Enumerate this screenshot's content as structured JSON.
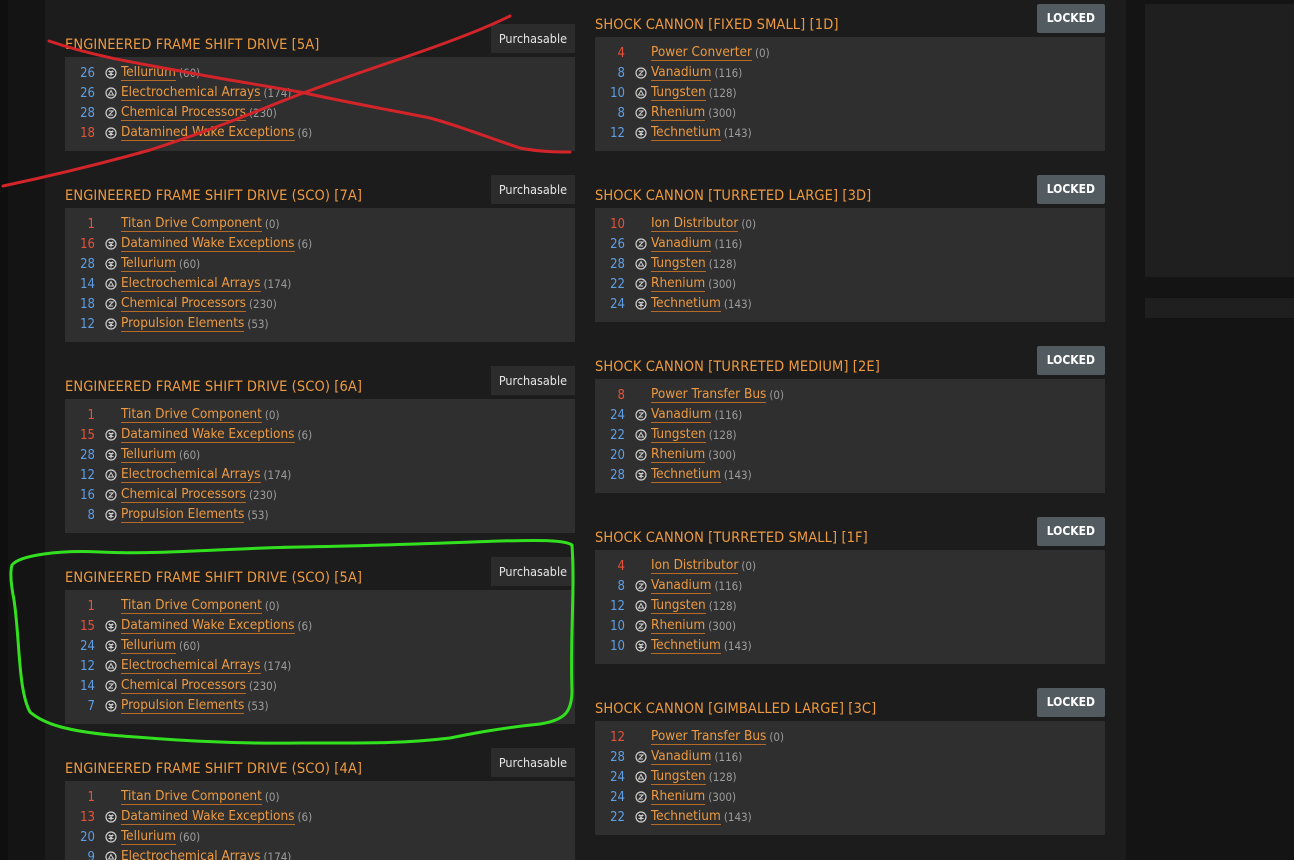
{
  "colors": {
    "accent_orange": "#ee9a40",
    "qty_blue": "#5e9fe6",
    "qty_red": "#e5533a",
    "locked_badge": "#525b60",
    "annotation_red": "#d3242a",
    "annotation_green": "#33e01f"
  },
  "icons": {
    "manufactured": "manufactured-material-icon",
    "raw": "raw-material-icon",
    "encoded": "encoded-data-icon",
    "none": ""
  },
  "left_cards": [
    {
      "title": "ENGINEERED FRAME SHIFT DRIVE [5A]",
      "badge": "Purchasable",
      "items": [
        {
          "qty": "26",
          "tone": "blue",
          "icon": "manufactured",
          "name": "Tellurium",
          "count": "(60)"
        },
        {
          "qty": "26",
          "tone": "blue",
          "icon": "raw",
          "name": "Electrochemical Arrays",
          "count": "(174)"
        },
        {
          "qty": "28",
          "tone": "blue",
          "icon": "encoded",
          "name": "Chemical Processors",
          "count": "(230)"
        },
        {
          "qty": "18",
          "tone": "red",
          "icon": "manufactured",
          "name": "Datamined Wake Exceptions",
          "count": "(6)"
        }
      ]
    },
    {
      "title": "ENGINEERED FRAME SHIFT DRIVE (SCO) [7A]",
      "badge": "Purchasable",
      "items": [
        {
          "qty": "1",
          "tone": "red",
          "icon": "none",
          "name": "Titan Drive Component",
          "count": "(0)"
        },
        {
          "qty": "16",
          "tone": "red",
          "icon": "manufactured",
          "name": "Datamined Wake Exceptions",
          "count": "(6)"
        },
        {
          "qty": "28",
          "tone": "blue",
          "icon": "manufactured",
          "name": "Tellurium",
          "count": "(60)"
        },
        {
          "qty": "14",
          "tone": "blue",
          "icon": "raw",
          "name": "Electrochemical Arrays",
          "count": "(174)"
        },
        {
          "qty": "18",
          "tone": "blue",
          "icon": "encoded",
          "name": "Chemical Processors",
          "count": "(230)"
        },
        {
          "qty": "12",
          "tone": "blue",
          "icon": "manufactured",
          "name": "Propulsion Elements",
          "count": "(53)"
        }
      ]
    },
    {
      "title": "ENGINEERED FRAME SHIFT DRIVE (SCO) [6A]",
      "badge": "Purchasable",
      "items": [
        {
          "qty": "1",
          "tone": "red",
          "icon": "none",
          "name": "Titan Drive Component",
          "count": "(0)"
        },
        {
          "qty": "15",
          "tone": "red",
          "icon": "manufactured",
          "name": "Datamined Wake Exceptions",
          "count": "(6)"
        },
        {
          "qty": "28",
          "tone": "blue",
          "icon": "manufactured",
          "name": "Tellurium",
          "count": "(60)"
        },
        {
          "qty": "12",
          "tone": "blue",
          "icon": "raw",
          "name": "Electrochemical Arrays",
          "count": "(174)"
        },
        {
          "qty": "16",
          "tone": "blue",
          "icon": "encoded",
          "name": "Chemical Processors",
          "count": "(230)"
        },
        {
          "qty": "8",
          "tone": "blue",
          "icon": "manufactured",
          "name": "Propulsion Elements",
          "count": "(53)"
        }
      ]
    },
    {
      "title": "ENGINEERED FRAME SHIFT DRIVE (SCO) [5A]",
      "badge": "Purchasable",
      "items": [
        {
          "qty": "1",
          "tone": "red",
          "icon": "none",
          "name": "Titan Drive Component",
          "count": "(0)"
        },
        {
          "qty": "15",
          "tone": "red",
          "icon": "manufactured",
          "name": "Datamined Wake Exceptions",
          "count": "(6)"
        },
        {
          "qty": "24",
          "tone": "blue",
          "icon": "manufactured",
          "name": "Tellurium",
          "count": "(60)"
        },
        {
          "qty": "12",
          "tone": "blue",
          "icon": "raw",
          "name": "Electrochemical Arrays",
          "count": "(174)"
        },
        {
          "qty": "14",
          "tone": "blue",
          "icon": "encoded",
          "name": "Chemical Processors",
          "count": "(230)"
        },
        {
          "qty": "7",
          "tone": "blue",
          "icon": "manufactured",
          "name": "Propulsion Elements",
          "count": "(53)"
        }
      ]
    },
    {
      "title": "ENGINEERED FRAME SHIFT DRIVE (SCO) [4A]",
      "badge": "Purchasable",
      "items": [
        {
          "qty": "1",
          "tone": "red",
          "icon": "none",
          "name": "Titan Drive Component",
          "count": "(0)"
        },
        {
          "qty": "13",
          "tone": "red",
          "icon": "manufactured",
          "name": "Datamined Wake Exceptions",
          "count": "(6)"
        },
        {
          "qty": "20",
          "tone": "blue",
          "icon": "manufactured",
          "name": "Tellurium",
          "count": "(60)"
        },
        {
          "qty": "9",
          "tone": "blue",
          "icon": "raw",
          "name": "Electrochemical Arrays",
          "count": "(174)"
        }
      ]
    }
  ],
  "right_cards": [
    {
      "title": "SHOCK CANNON [FIXED SMALL] [1D]",
      "badge": "LOCKED",
      "items": [
        {
          "qty": "4",
          "tone": "red",
          "icon": "none",
          "name": "Power Converter",
          "count": "(0)"
        },
        {
          "qty": "8",
          "tone": "blue",
          "icon": "encoded",
          "name": "Vanadium",
          "count": "(116)"
        },
        {
          "qty": "10",
          "tone": "blue",
          "icon": "raw",
          "name": "Tungsten",
          "count": "(128)"
        },
        {
          "qty": "8",
          "tone": "blue",
          "icon": "encoded",
          "name": "Rhenium",
          "count": "(300)"
        },
        {
          "qty": "12",
          "tone": "blue",
          "icon": "manufactured",
          "name": "Technetium",
          "count": "(143)"
        }
      ]
    },
    {
      "title": "SHOCK CANNON [TURRETED LARGE] [3D]",
      "badge": "LOCKED",
      "items": [
        {
          "qty": "10",
          "tone": "red",
          "icon": "none",
          "name": "Ion Distributor",
          "count": "(0)"
        },
        {
          "qty": "26",
          "tone": "blue",
          "icon": "encoded",
          "name": "Vanadium",
          "count": "(116)"
        },
        {
          "qty": "28",
          "tone": "blue",
          "icon": "raw",
          "name": "Tungsten",
          "count": "(128)"
        },
        {
          "qty": "22",
          "tone": "blue",
          "icon": "encoded",
          "name": "Rhenium",
          "count": "(300)"
        },
        {
          "qty": "24",
          "tone": "blue",
          "icon": "manufactured",
          "name": "Technetium",
          "count": "(143)"
        }
      ]
    },
    {
      "title": "SHOCK CANNON [TURRETED MEDIUM] [2E]",
      "badge": "LOCKED",
      "items": [
        {
          "qty": "8",
          "tone": "red",
          "icon": "none",
          "name": "Power Transfer Bus",
          "count": "(0)"
        },
        {
          "qty": "24",
          "tone": "blue",
          "icon": "encoded",
          "name": "Vanadium",
          "count": "(116)"
        },
        {
          "qty": "22",
          "tone": "blue",
          "icon": "raw",
          "name": "Tungsten",
          "count": "(128)"
        },
        {
          "qty": "20",
          "tone": "blue",
          "icon": "encoded",
          "name": "Rhenium",
          "count": "(300)"
        },
        {
          "qty": "28",
          "tone": "blue",
          "icon": "manufactured",
          "name": "Technetium",
          "count": "(143)"
        }
      ]
    },
    {
      "title": "SHOCK CANNON [TURRETED SMALL] [1F]",
      "badge": "LOCKED",
      "items": [
        {
          "qty": "4",
          "tone": "red",
          "icon": "none",
          "name": "Ion Distributor",
          "count": "(0)"
        },
        {
          "qty": "8",
          "tone": "blue",
          "icon": "encoded",
          "name": "Vanadium",
          "count": "(116)"
        },
        {
          "qty": "12",
          "tone": "blue",
          "icon": "raw",
          "name": "Tungsten",
          "count": "(128)"
        },
        {
          "qty": "10",
          "tone": "blue",
          "icon": "encoded",
          "name": "Rhenium",
          "count": "(300)"
        },
        {
          "qty": "10",
          "tone": "blue",
          "icon": "manufactured",
          "name": "Technetium",
          "count": "(143)"
        }
      ]
    },
    {
      "title": "SHOCK CANNON [GIMBALLED LARGE] [3C]",
      "badge": "LOCKED",
      "items": [
        {
          "qty": "12",
          "tone": "red",
          "icon": "none",
          "name": "Power Transfer Bus",
          "count": "(0)"
        },
        {
          "qty": "28",
          "tone": "blue",
          "icon": "encoded",
          "name": "Vanadium",
          "count": "(116)"
        },
        {
          "qty": "24",
          "tone": "blue",
          "icon": "raw",
          "name": "Tungsten",
          "count": "(128)"
        },
        {
          "qty": "24",
          "tone": "blue",
          "icon": "encoded",
          "name": "Rhenium",
          "count": "(300)"
        },
        {
          "qty": "22",
          "tone": "blue",
          "icon": "manufactured",
          "name": "Technetium",
          "count": "(143)"
        }
      ]
    }
  ]
}
